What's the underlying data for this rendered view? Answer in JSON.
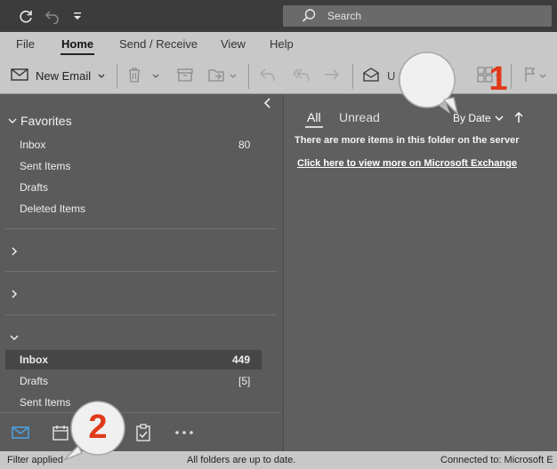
{
  "titlebar": {
    "search_placeholder": "Search"
  },
  "ribbon": {
    "tabs": [
      "File",
      "Home",
      "Send / Receive",
      "View",
      "Help"
    ],
    "active_tab": "Home",
    "new_email_label": "New Email",
    "unread_label_partial": "U"
  },
  "folders": {
    "favorites_label": "Favorites",
    "favorites": [
      {
        "label": "Inbox",
        "count": "80"
      },
      {
        "label": "Sent Items",
        "count": ""
      },
      {
        "label": "Drafts",
        "count": ""
      },
      {
        "label": "Deleted Items",
        "count": ""
      }
    ],
    "account_folders": [
      {
        "label": "Inbox",
        "count": "449"
      },
      {
        "label": "Drafts",
        "count": "[5]"
      },
      {
        "label": "Sent Items",
        "count": ""
      }
    ]
  },
  "message_list": {
    "filter_all": "All",
    "filter_unread": "Unread",
    "sort_label": "By Date",
    "server_notice": "There are more items in this folder on the server",
    "exchange_link": "Click here to view more on Microsoft Exchange"
  },
  "statusbar": {
    "filter": "Filter applied",
    "sync": "All folders are up to date.",
    "connection": "Connected to: Microsoft E"
  },
  "callouts": [
    "1",
    "2"
  ],
  "colors": {
    "callout_number": "#e03a1a",
    "ribbon_bg": "#c8c8c8",
    "pane_bg": "#5b5b5b",
    "mail_icon": "#4a9fe0"
  }
}
